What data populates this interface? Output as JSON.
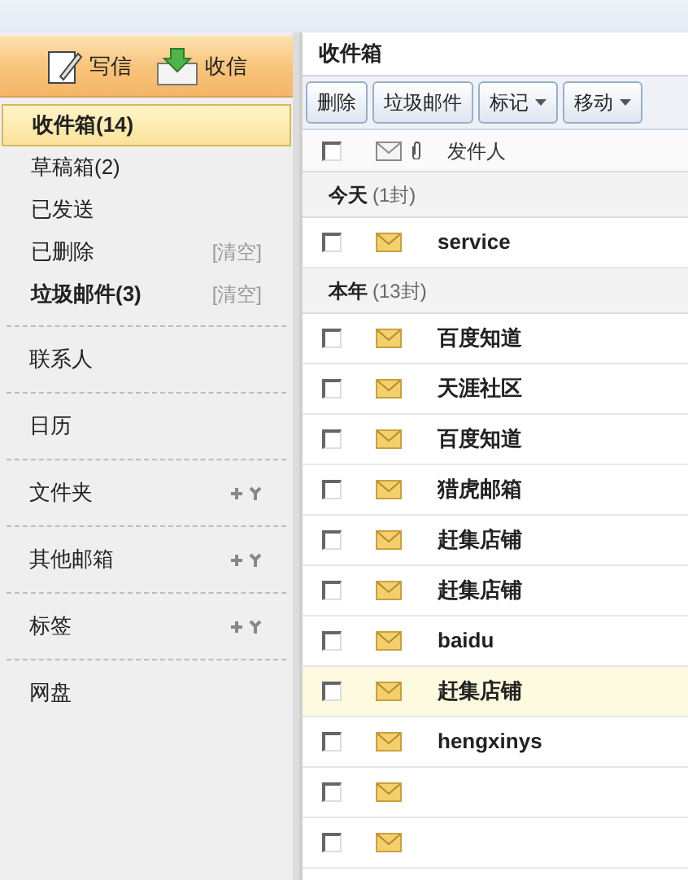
{
  "top_actions": [
    {
      "kind": "compose",
      "label": "写信"
    },
    {
      "kind": "receive",
      "label": "收信"
    }
  ],
  "folders": [
    {
      "label": "收件箱(14)",
      "bold": true,
      "selected": true
    },
    {
      "label": "草稿箱(2)",
      "bold": false,
      "selected": false
    },
    {
      "label": "已发送",
      "bold": false,
      "selected": false
    },
    {
      "label": "已删除",
      "bold": false,
      "selected": false,
      "action": "[清空]"
    },
    {
      "label": "垃圾邮件(3)",
      "bold": true,
      "selected": false,
      "action": "[清空]"
    }
  ],
  "sections": [
    {
      "label": "联系人",
      "tools": false
    },
    {
      "label": "日历",
      "tools": false
    },
    {
      "label": "文件夹",
      "tools": true
    },
    {
      "label": "其他邮箱",
      "tools": true
    },
    {
      "label": "标签",
      "tools": true
    },
    {
      "label": "网盘",
      "tools": false
    }
  ],
  "main": {
    "title": "收件箱",
    "toolbar": [
      {
        "label": "删除",
        "dropdown": false
      },
      {
        "label": "垃圾邮件",
        "dropdown": false
      },
      {
        "label": "标记",
        "dropdown": true
      },
      {
        "label": "移动",
        "dropdown": true
      }
    ],
    "columns": {
      "sender": "发件人",
      "select_all_checked": false
    },
    "groups": [
      {
        "label": "今天",
        "count": "(1封)",
        "rows": [
          {
            "sender": "service",
            "bold": true,
            "selected": false,
            "checked": false
          }
        ]
      },
      {
        "label": "本年",
        "count": "(13封)",
        "rows": [
          {
            "sender": "百度知道",
            "bold": true,
            "selected": false,
            "checked": false
          },
          {
            "sender": "天涯社区",
            "bold": true,
            "selected": false,
            "checked": false
          },
          {
            "sender": "百度知道",
            "bold": true,
            "selected": false,
            "checked": false
          },
          {
            "sender": "猎虎邮箱",
            "bold": true,
            "selected": false,
            "checked": false
          },
          {
            "sender": "赶集店铺",
            "bold": true,
            "selected": false,
            "checked": false
          },
          {
            "sender": "赶集店铺",
            "bold": true,
            "selected": false,
            "checked": false
          },
          {
            "sender": "baidu",
            "bold": true,
            "selected": false,
            "checked": false
          },
          {
            "sender": "赶集店铺",
            "bold": true,
            "selected": true,
            "checked": false
          },
          {
            "sender": "hengxinys",
            "bold": true,
            "selected": false,
            "checked": false
          },
          {
            "selected": false,
            "checked": false
          },
          {
            "selected": false,
            "checked": false
          }
        ]
      }
    ]
  }
}
